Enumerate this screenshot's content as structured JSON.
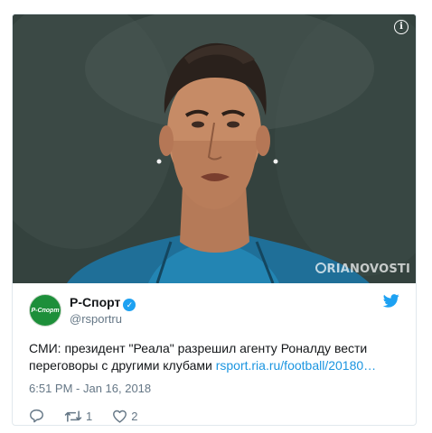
{
  "media": {
    "watermark": "RIANOVOSTI",
    "info_icon": "info-icon"
  },
  "author": {
    "avatar_text": "Р-Спорт",
    "display_name": "Р-Спорт",
    "handle": "@rsportru",
    "verified": true
  },
  "tweet": {
    "text": "СМИ: президент \"Реала\" разрешил агенту Роналду вести переговоры с другими клубами ",
    "link": "rsport.ria.ru/football/20180…",
    "timestamp": "6:51 PM - Jan 16, 2018"
  },
  "actions": {
    "reply_icon": "reply-icon",
    "retweet_count": "1",
    "like_count": "2"
  },
  "colors": {
    "link": "#1b95e0",
    "verified": "#1da1f2",
    "twitter_blue": "#1da1f2",
    "muted": "#657786"
  }
}
